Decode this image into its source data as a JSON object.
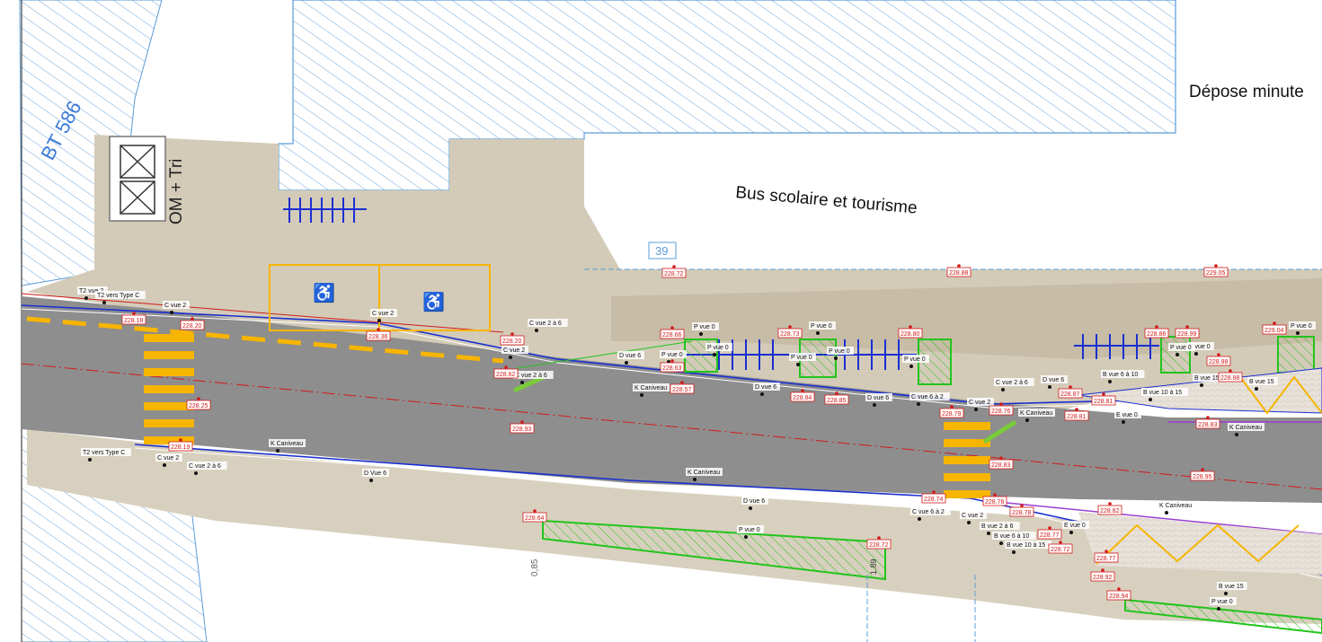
{
  "labels": {
    "depose_minute": "Dépose minute",
    "bus_scolaire": "Bus scolaire et tourisme",
    "om_tri": "OM + Tri",
    "parcel": "BT 586",
    "place_number": "39",
    "dim_085": "0,85",
    "dim_189": "1.89"
  },
  "kerb_labels": [
    "T2 vue 2",
    "T2 vers Type C",
    "C vue 2",
    "C vue 2",
    "C vue 2 à 6",
    "C vue 2",
    "C vue 2 à 6",
    "D vue 6",
    "P vue 0",
    "P vue 0",
    "P vue 0",
    "P vue 0",
    "P vue 0",
    "P vue 0",
    "P vue 0",
    "K Caniveau",
    "D vue 6",
    "D vue 6",
    "C vue 6 à 2",
    "C vue 2 à 6",
    "C vue 2",
    "D vue 6",
    "K Caniveau",
    "B vue 6 à 10",
    "B vue 10 à 15",
    "B vue 15",
    "E vue 0",
    "K Caniveau",
    "P vue 0",
    "B vue 15",
    "P vue 0",
    "T2 vers Type C",
    "C vue 2",
    "C vue 2 à 6",
    "K Caniveau",
    "D Vue 6",
    "K Caniveau",
    "D vue 6",
    "P vue 0",
    "C vue 6 à 2",
    "C vue 2",
    "B vue 2 à 6",
    "B vue 6 à 10",
    "B vue 10 à 15",
    "E vue 0",
    "K Caniveau",
    "B vue 15",
    "P vue 0",
    "P vue 0"
  ],
  "elevations": [
    "228.18",
    "228.20",
    "228.36",
    "228.20",
    "228.62",
    "228.25",
    "228.19",
    "228.72",
    "228.66",
    "228.63",
    "228.57",
    "228.73",
    "228.84",
    "228.85",
    "228.80",
    "228.79",
    "228.76",
    "228.88",
    "228.93",
    "228.86",
    "228.99",
    "228.87",
    "228.81",
    "228.81",
    "229.05",
    "229.04",
    "228.98",
    "228.88",
    "228.83",
    "228.83",
    "228.95",
    "228.74",
    "228.76",
    "228.78",
    "228.77",
    "228.72",
    "228.64",
    "228.72",
    "228.82",
    "228.77",
    "228.92",
    "228.94"
  ],
  "colors": {
    "road": "#8e8e8e",
    "paving": "#d3cbb8",
    "hatch": "#5b9bd5",
    "yellow": "#f7b500",
    "green": "#22c41c",
    "kerb_blue": "#1a2fd0",
    "red_axis": "#d21a1a",
    "purple": "#9a3fd0"
  }
}
